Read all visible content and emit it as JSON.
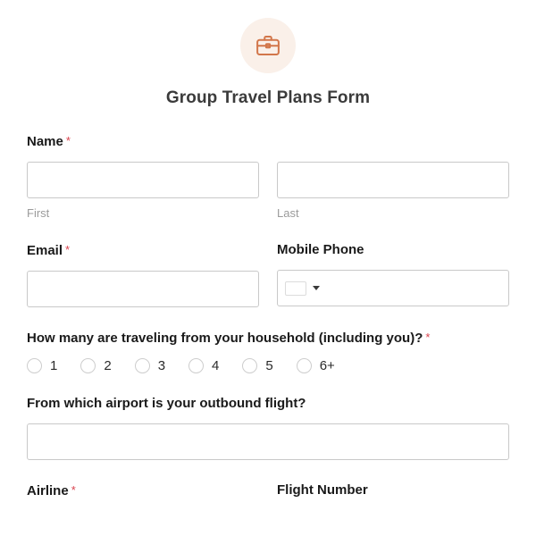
{
  "header": {
    "icon": "briefcase-icon",
    "icon_color": "#d2764a",
    "icon_bg_color": "#faf0e9",
    "title": "Group Travel Plans Form"
  },
  "theme": {
    "required_marker": "*",
    "required_color": "#d9434e",
    "label_color": "#1a1a1a",
    "sublabel_color": "#9b9b9b",
    "input_border_color": "#c9c9c9",
    "page_background": "#ffffff"
  },
  "fields": {
    "name": {
      "label": "Name",
      "required": true,
      "first": {
        "sub_label": "First",
        "value": "",
        "placeholder": ""
      },
      "last": {
        "sub_label": "Last",
        "value": "",
        "placeholder": ""
      }
    },
    "email": {
      "label": "Email",
      "required": true,
      "value": "",
      "placeholder": ""
    },
    "mobile_phone": {
      "label": "Mobile Phone",
      "required": false,
      "value": "",
      "placeholder": "",
      "country_selector": {
        "icon": "flag-placeholder-icon",
        "caret_icon": "chevron-down-icon",
        "selected": ""
      }
    },
    "household_count": {
      "label": "How many are traveling from your household (including you)?",
      "required": true,
      "options": [
        "1",
        "2",
        "3",
        "4",
        "5",
        "6+"
      ],
      "selected": null
    },
    "outbound_airport": {
      "label": "From which airport is your outbound flight?",
      "required": false,
      "value": "",
      "placeholder": ""
    },
    "airline": {
      "label": "Airline",
      "required": true
    },
    "flight_number": {
      "label": "Flight Number",
      "required": false
    }
  }
}
